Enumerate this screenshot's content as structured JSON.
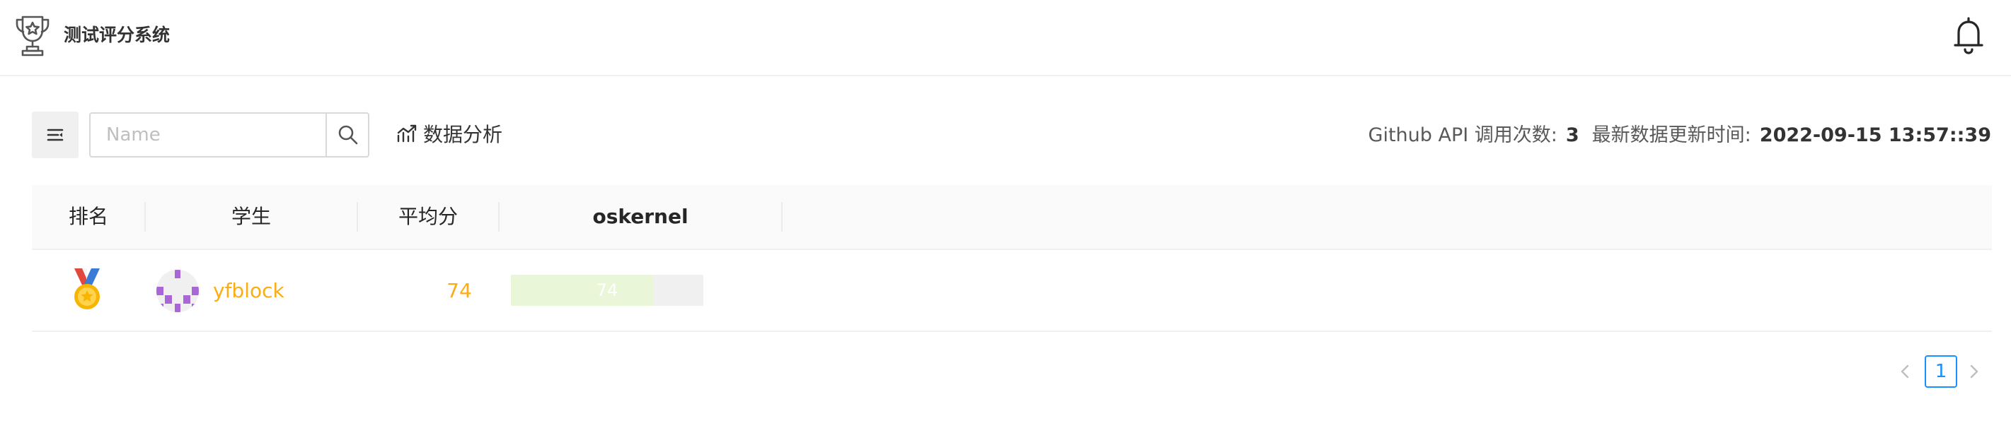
{
  "header": {
    "title": "测试评分系统",
    "logo_icon": "trophy-icon",
    "notification_icon": "bell-icon"
  },
  "toolbar": {
    "menu_icon": "menu-fold-icon",
    "search": {
      "placeholder": "Name",
      "value": ""
    },
    "search_icon": "search-icon",
    "analysis_label": "数据分析",
    "analysis_icon": "stock-chart-icon"
  },
  "stats": {
    "api_label": "Github API 调用次数:",
    "api_count": "3",
    "updated_label": "最新数据更新时间:",
    "updated_value": "2022-09-15 13:57::39"
  },
  "table": {
    "columns": [
      "排名",
      "学生",
      "平均分",
      "oskernel"
    ],
    "rows": [
      {
        "rank_icon": "gold-medal-icon",
        "student": "yfblock",
        "average": "74",
        "oskernel": "74",
        "oskernel_fraction": 0.74
      }
    ]
  },
  "pagination": {
    "current": "1",
    "prev_icon": "chevron-left-icon",
    "next_icon": "chevron-right-icon"
  },
  "colors": {
    "accent": "#1890ff",
    "score": "#faad14",
    "bar_fill": "#e9f6d8",
    "avatar": "#a866d6"
  }
}
